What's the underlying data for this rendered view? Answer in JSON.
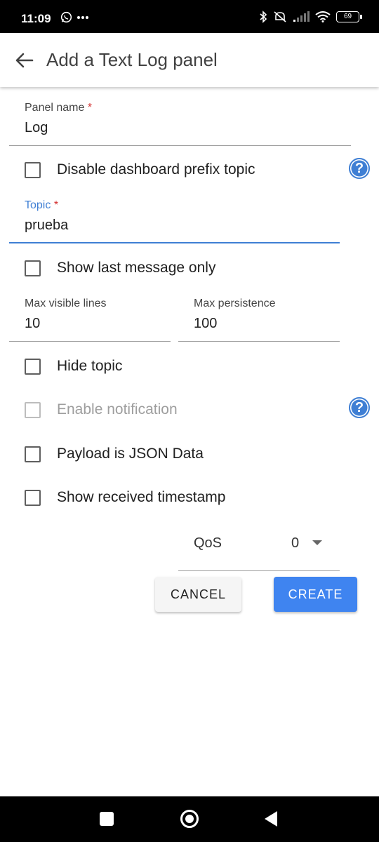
{
  "status_bar": {
    "time": "11:09",
    "left_icons": [
      "whatsapp-icon",
      "more-dots-icon"
    ],
    "right_icons": [
      "bluetooth-icon",
      "mute-icon",
      "signal-icon",
      "wifi-icon"
    ],
    "battery": "69"
  },
  "app_bar": {
    "title": "Add a Text Log panel"
  },
  "form": {
    "panel_name": {
      "label": "Panel name",
      "required_mark": "*",
      "value": "Log"
    },
    "disable_prefix": {
      "label": "Disable dashboard prefix topic",
      "checked": false
    },
    "topic": {
      "label": "Topic",
      "required_mark": "*",
      "value": "prueba"
    },
    "show_last": {
      "label": "Show last message only",
      "checked": false
    },
    "max_visible_lines": {
      "label": "Max visible lines",
      "value": "10"
    },
    "max_persistence": {
      "label": "Max persistence",
      "value": "100"
    },
    "hide_topic": {
      "label": "Hide topic",
      "checked": false
    },
    "enable_notification": {
      "label": "Enable notification",
      "checked": false,
      "disabled": true
    },
    "payload_json": {
      "label": "Payload is JSON Data",
      "checked": false
    },
    "show_timestamp": {
      "label": "Show received timestamp",
      "checked": false
    },
    "qos": {
      "label": "QoS",
      "value": "0"
    }
  },
  "actions": {
    "cancel": "CANCEL",
    "create": "CREATE"
  },
  "colors": {
    "accent": "#3f7fd4",
    "create_button": "#3f84f0",
    "required": "#d32f2f"
  }
}
